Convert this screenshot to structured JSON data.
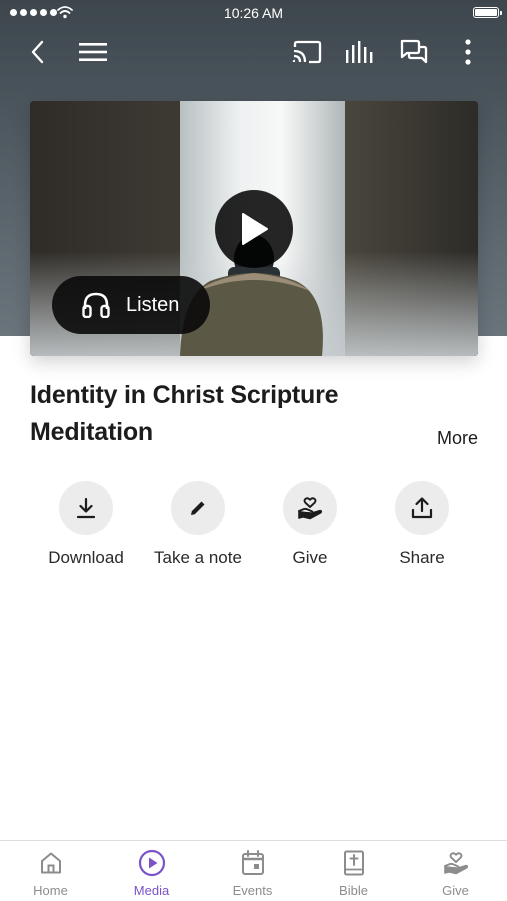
{
  "status_bar": {
    "time": "10:26 AM"
  },
  "toolbar": {
    "back_icon": "chevron-left-icon",
    "menu_icon": "hamburger-menu-icon",
    "cast_icon": "cast-icon",
    "levels_icon": "audio-levels-icon",
    "chat_icon": "chat-bubbles-icon",
    "more_icon": "more-vertical-icon"
  },
  "video": {
    "play_icon": "play-icon",
    "listen_label": "Listen",
    "listen_icon": "headphones-icon"
  },
  "content": {
    "title": "Identity in Christ Scripture Meditation",
    "more_label": "More"
  },
  "actions": [
    {
      "label": "Download",
      "icon": "download-icon"
    },
    {
      "label": "Take a note",
      "icon": "pencil-icon"
    },
    {
      "label": "Give",
      "icon": "heart-hand-icon"
    },
    {
      "label": "Share",
      "icon": "share-icon"
    }
  ],
  "tabs": [
    {
      "label": "Home",
      "icon": "home-icon",
      "active": false
    },
    {
      "label": "Media",
      "icon": "play-circle-icon",
      "active": true
    },
    {
      "label": "Events",
      "icon": "calendar-icon",
      "active": false
    },
    {
      "label": "Bible",
      "icon": "bible-icon",
      "active": false
    },
    {
      "label": "Give",
      "icon": "heart-hand-icon",
      "active": false
    }
  ],
  "colors": {
    "accent": "#7a53c7",
    "header_background": "#4a535a",
    "tab_inactive": "#8c8c8c",
    "action_circle": "#ececec"
  }
}
